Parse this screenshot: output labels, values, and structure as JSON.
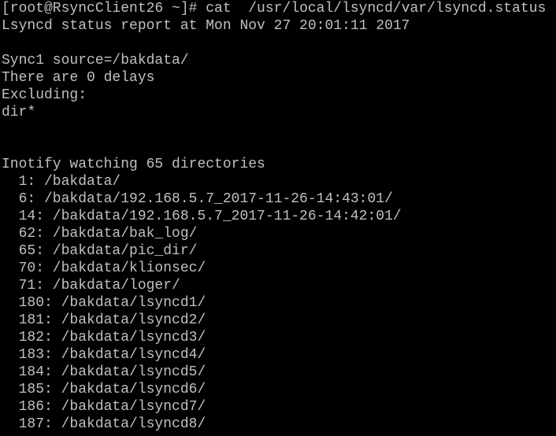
{
  "terminal": {
    "prompt": "[root@RsyncClient26 ~]# ",
    "command": "cat  /usr/local/lsyncd/var/lsyncd.status",
    "report_header": "Lsyncd status report at Mon Nov 27 20:01:11 2017",
    "sync_source": "Sync1 source=/bakdata/",
    "delays": "There are 0 delays",
    "excluding_label": "Excluding:",
    "exclude_pattern": "dir*",
    "inotify_summary": "Inotify watching 65 directories",
    "watched": [
      "  1: /bakdata/",
      "  6: /bakdata/192.168.5.7_2017-11-26-14:43:01/",
      "  14: /bakdata/192.168.5.7_2017-11-26-14:42:01/",
      "  62: /bakdata/bak_log/",
      "  65: /bakdata/pic_dir/",
      "  70: /bakdata/klionsec/",
      "  71: /bakdata/loger/",
      "  180: /bakdata/lsyncd1/",
      "  181: /bakdata/lsyncd2/",
      "  182: /bakdata/lsyncd3/",
      "  183: /bakdata/lsyncd4/",
      "  184: /bakdata/lsyncd5/",
      "  185: /bakdata/lsyncd6/",
      "  186: /bakdata/lsyncd7/",
      "  187: /bakdata/lsyncd8/"
    ]
  },
  "colors": {
    "background": "#000000",
    "foreground": "#c0c0c0"
  }
}
